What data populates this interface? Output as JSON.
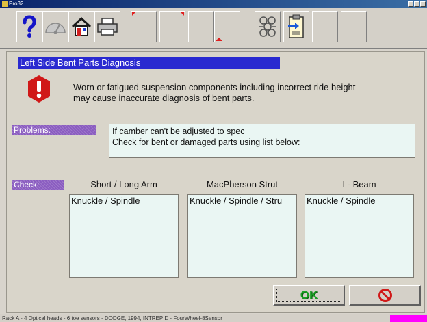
{
  "window": {
    "title": "Pro32"
  },
  "toolbar": {
    "buttons": [
      {
        "icon": "help-icon"
      },
      {
        "icon": "gauge-icon"
      },
      {
        "icon": "home-icon"
      },
      {
        "icon": "printer-icon"
      },
      {
        "icon": "blank"
      },
      {
        "icon": "blank"
      },
      {
        "icon": "blank"
      },
      {
        "icon": "blank"
      },
      {
        "icon": "wheel-pattern-icon"
      },
      {
        "icon": "clipboard-arrow-icon"
      },
      {
        "icon": "blank"
      },
      {
        "icon": "blank"
      }
    ]
  },
  "dialog": {
    "header": "Left Side Bent Parts Diagnosis",
    "warning_line1": "Worn or fatigued suspension components including incorrect ride height",
    "warning_line2": "may cause inaccurate diagnosis of bent parts.",
    "problems_label": "Problems:",
    "problems_line1": "If camber can't be adjusted to spec",
    "problems_line2": "Check for bent or damaged parts using list below:",
    "check_label": "Check:",
    "columns": [
      {
        "heading": "Short / Long Arm",
        "items": [
          "Knuckle / Spindle"
        ]
      },
      {
        "heading": "MacPherson Strut",
        "items": [
          "Knuckle / Spindle / Stru"
        ]
      },
      {
        "heading": "I - Beam",
        "items": [
          "Knuckle / Spindle"
        ]
      }
    ],
    "ok_label": "OK"
  },
  "status": {
    "text": "Rack A - 4 Optical heads - 6 toe sensors - DODGE, 1994, INTREPID - FourWheel-8Sensor"
  },
  "colors": {
    "header_bg": "#2a2ad0",
    "tag_bg": "#8a5cc0",
    "list_bg": "#eaf6f3",
    "ok_green": "#1aa024",
    "cancel_red": "#d01818",
    "status_marker": "#ff00ff"
  }
}
